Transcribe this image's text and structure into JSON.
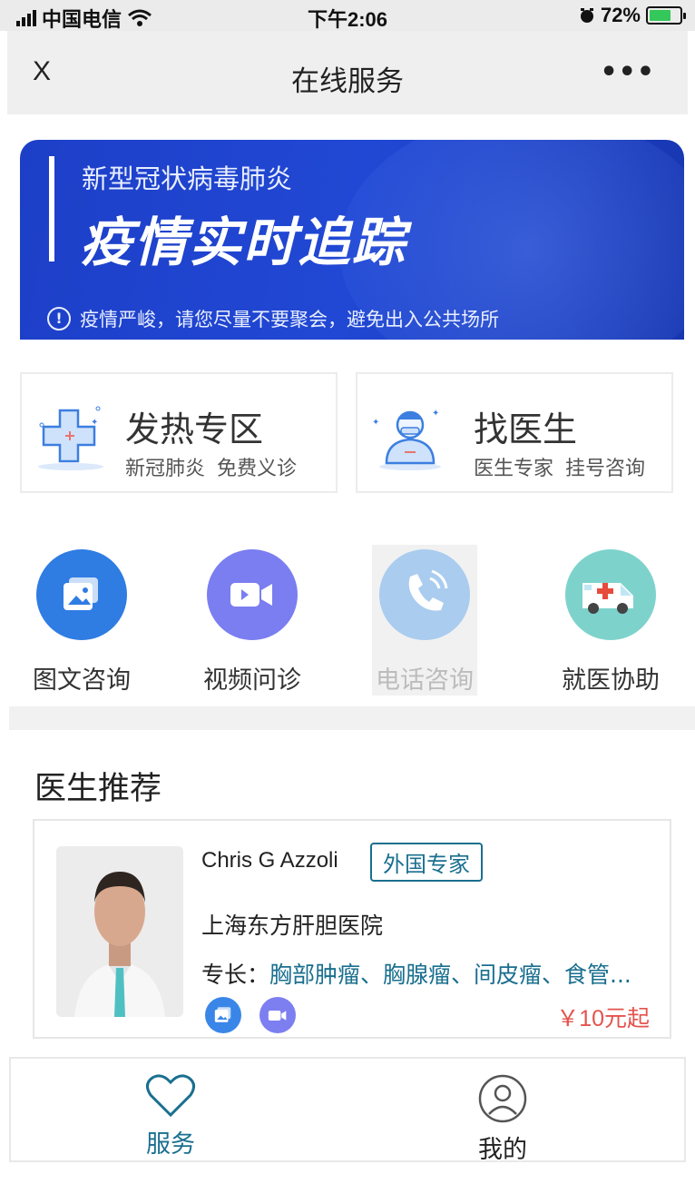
{
  "status_bar": {
    "carrier": "中国电信",
    "time": "下午2:06",
    "battery": "72%"
  },
  "nav": {
    "close": "X",
    "title": "在线服务",
    "more": "•••"
  },
  "banner": {
    "subtitle": "新型冠状病毒肺炎",
    "title": "疫情实时追踪",
    "notice": "疫情严峻，请您尽量不要聚会，避免出入公共场所"
  },
  "cards": [
    {
      "title": "发热专区",
      "desc": "新冠肺炎 免费义诊"
    },
    {
      "title": "找医生",
      "desc": "医生专家 挂号咨询"
    }
  ],
  "services": [
    {
      "label": "图文咨询",
      "color": "#2f7ce3"
    },
    {
      "label": "视频问诊",
      "color": "#7b7ef0"
    },
    {
      "label": "电话咨询",
      "color": "#a9ccef"
    },
    {
      "label": "就医协助",
      "color": "#7dd3cc"
    }
  ],
  "recommend": {
    "title": "医生推荐",
    "doctor": {
      "name": "Chris G Azzoli",
      "badge": "外国专家",
      "hospital": "上海东方肝胆医院",
      "specialty_label": "专长：",
      "specialty": "胸部肿瘤、胸腺瘤、间皮瘤、食管...",
      "price": "￥10元起"
    }
  },
  "tabbar": {
    "service": "服务",
    "mine": "我的"
  },
  "colors": {
    "accent": "#1a6f8f",
    "price": "#e4534d",
    "banner": "#1d3fc8"
  }
}
